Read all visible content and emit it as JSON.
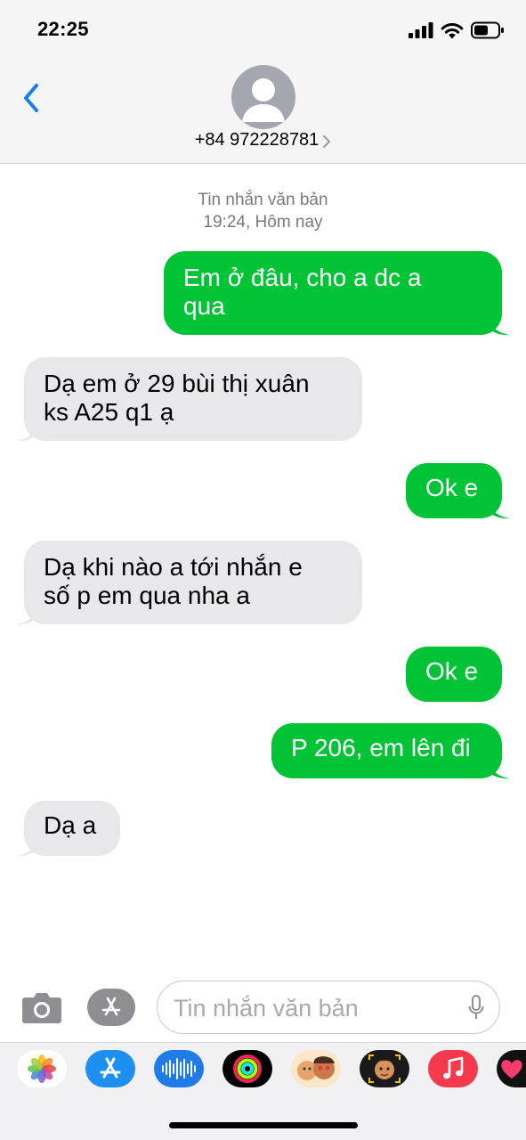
{
  "status_bar": {
    "time": "22:25"
  },
  "header": {
    "contact": "+84 972228781"
  },
  "conversation": {
    "meta_label": "Tin nhắn văn bản",
    "meta_time": "19:24, Hôm nay",
    "messages": [
      {
        "direction": "outgoing",
        "lines": [
          "Em ở đâu, cho a dc a",
          "qua"
        ]
      },
      {
        "direction": "incoming",
        "lines": [
          "Dạ em ở 29 bùi thị xuân",
          "ks A25 q1 ạ"
        ]
      },
      {
        "direction": "outgoing",
        "lines": [
          "Ok e"
        ]
      },
      {
        "direction": "incoming",
        "lines": [
          "Dạ khi nào a tới nhắn e",
          "số p em qua nha a"
        ]
      },
      {
        "direction": "outgoing",
        "lines": [
          "Ok e"
        ]
      },
      {
        "direction": "outgoing",
        "lines": [
          "P 206, em lên đi"
        ]
      },
      {
        "direction": "incoming",
        "lines": [
          "Dạ a"
        ]
      }
    ]
  },
  "composer": {
    "placeholder": "Tin nhắn văn bản"
  },
  "app_drawer": {
    "apps": [
      "photos-app",
      "app-store-app",
      "audio-message-app",
      "activity-app",
      "memoji-stickers-app",
      "animoji-app",
      "music-app",
      "digital-touch-app"
    ]
  },
  "colors": {
    "outgoing_bubble": "#00c436",
    "incoming_bubble": "#e8e8ea",
    "accent": "#1a7cf5"
  }
}
